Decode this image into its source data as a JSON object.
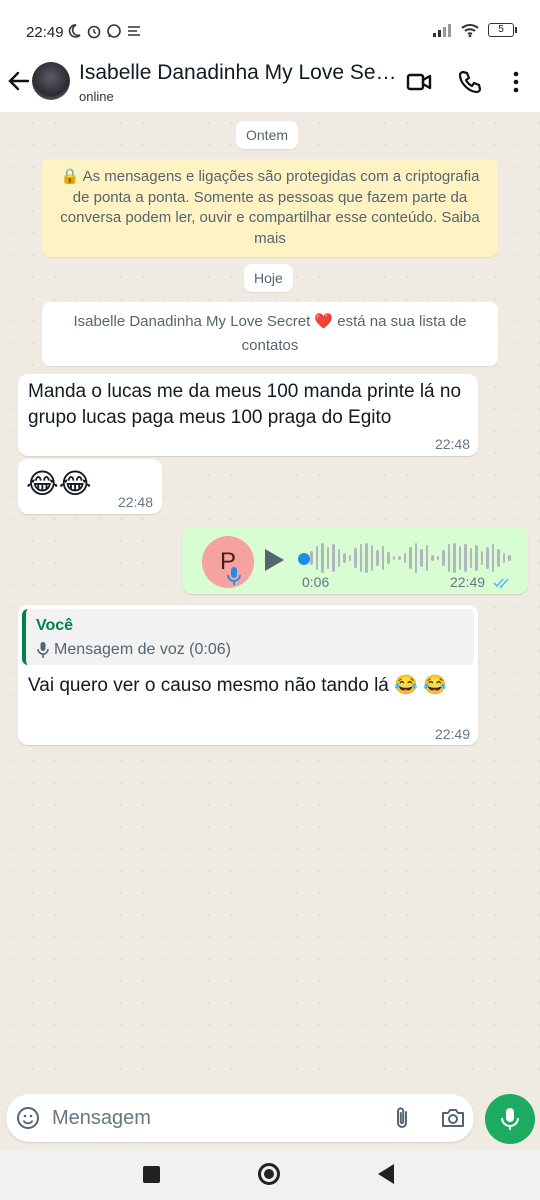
{
  "status_bar": {
    "time": "22:49",
    "battery": "5"
  },
  "header": {
    "contact_name": "Isabelle Danadinha My Love Secret ❤️",
    "status": "online"
  },
  "chat": {
    "date_yesterday": "Ontem",
    "encryption_notice": "🔒 As mensagens e ligações são protegidas com a criptografia de ponta a ponta. Somente as pessoas que fazem parte da conversa podem ler, ouvir e compartilhar esse conteúdo. Saiba mais",
    "date_today": "Hoje",
    "contact_notice": "Isabelle Danadinha My Love Secret ❤️ está na sua lista de contatos",
    "messages": [
      {
        "direction": "in",
        "text": "Manda o lucas me da meus 100 manda printe lá no grupo lucas paga meus 100 praga do Egito",
        "time": "22:48"
      },
      {
        "direction": "in",
        "text": "😂😂",
        "time": "22:48"
      },
      {
        "direction": "out",
        "type": "voice",
        "avatar_letter": "P",
        "duration": "0:06",
        "time": "22:49",
        "status": "read"
      },
      {
        "direction": "in",
        "quote_author": "Você",
        "quote_text": "Mensagem de voz (0:06)",
        "text": "Vai quero ver o causo mesmo não tando lá 😂 😂",
        "time": "22:49"
      }
    ]
  },
  "composer": {
    "placeholder": "Mensagem"
  },
  "colors": {
    "accent_green": "#1daa61",
    "outgoing_bubble": "#d9fdd3",
    "read_ticks": "#53bdeb",
    "quote_author": "#06804b"
  }
}
